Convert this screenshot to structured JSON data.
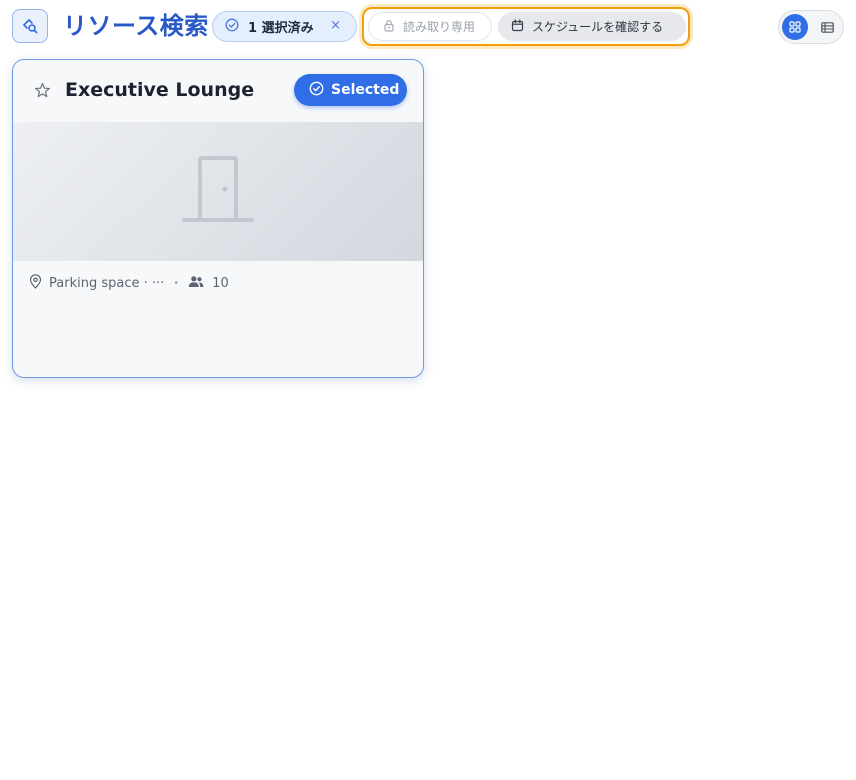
{
  "header": {
    "title": "リソース検索",
    "selection_count": "1 選択済み",
    "clear_label": "×",
    "readonly_label": "読み取り専用",
    "schedule_label": "スケジュールを確認する"
  },
  "card": {
    "title": "Executive Lounge",
    "selected_label": "Selected",
    "location": "Parking space · ···",
    "capacity": "10"
  },
  "icons": {
    "app": "search-resource-icon",
    "check": "check-circle-icon",
    "lock": "lock-icon",
    "calendar": "calendar-icon",
    "grid": "grid-view-icon",
    "list": "list-view-icon",
    "star": "star-icon",
    "door": "door-icon",
    "pin": "location-pin-icon",
    "people": "people-icon"
  },
  "colors": {
    "accent": "#2f6ee6",
    "title": "#2857c9",
    "highlight": "#f59e0b"
  }
}
